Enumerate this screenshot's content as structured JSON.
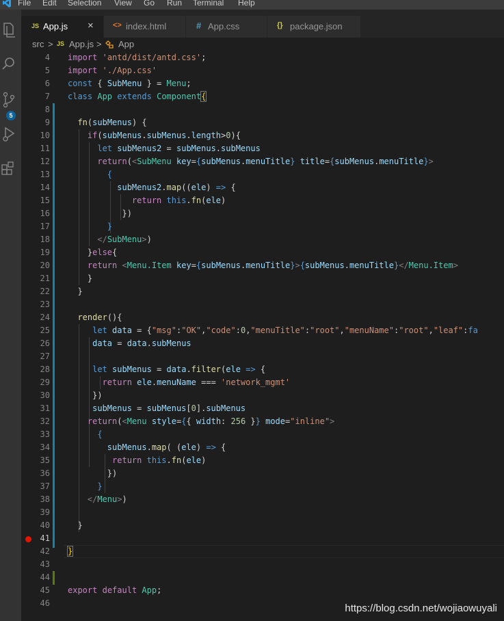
{
  "menubar": {
    "items": [
      "File",
      "Edit",
      "Selection",
      "View",
      "Go",
      "Run",
      "Terminal",
      "Help"
    ]
  },
  "activity": {
    "scm_badge": "5"
  },
  "tabs": [
    {
      "icon": "JS",
      "label": "App.js",
      "close": "×",
      "active": true,
      "icon_color": "#cbcb41"
    },
    {
      "icon": "<>",
      "label": "index.html",
      "active": false,
      "icon_color": "#e37933"
    },
    {
      "icon": "#",
      "label": "App.css",
      "active": false,
      "icon_color": "#519aba"
    },
    {
      "icon": "{}",
      "label": "package.json",
      "active": false,
      "icon_color": "#cbcb41"
    }
  ],
  "breadcrumb": {
    "folder": "src",
    "sep1": ">",
    "file_icon": "JS",
    "file": "App.js",
    "sep2": ">",
    "symbol": "App"
  },
  "editor": {
    "line_numbers": [
      "4",
      "5",
      "6",
      "7",
      "8",
      "9",
      "10",
      "11",
      "12",
      "13",
      "14",
      "15",
      "16",
      "17",
      "18",
      "19",
      "20",
      "21",
      "22",
      "23",
      "24",
      "25",
      "26",
      "27",
      "28",
      "29",
      "30",
      "31",
      "32",
      "33",
      "34",
      "35",
      "36",
      "37",
      "38",
      "39",
      "40",
      "41",
      "42",
      "43",
      "44",
      "45",
      "46"
    ],
    "current_line": "41",
    "breakpoint_line": "41"
  },
  "watermark": "https://blog.csdn.net/wojiaowuyali"
}
